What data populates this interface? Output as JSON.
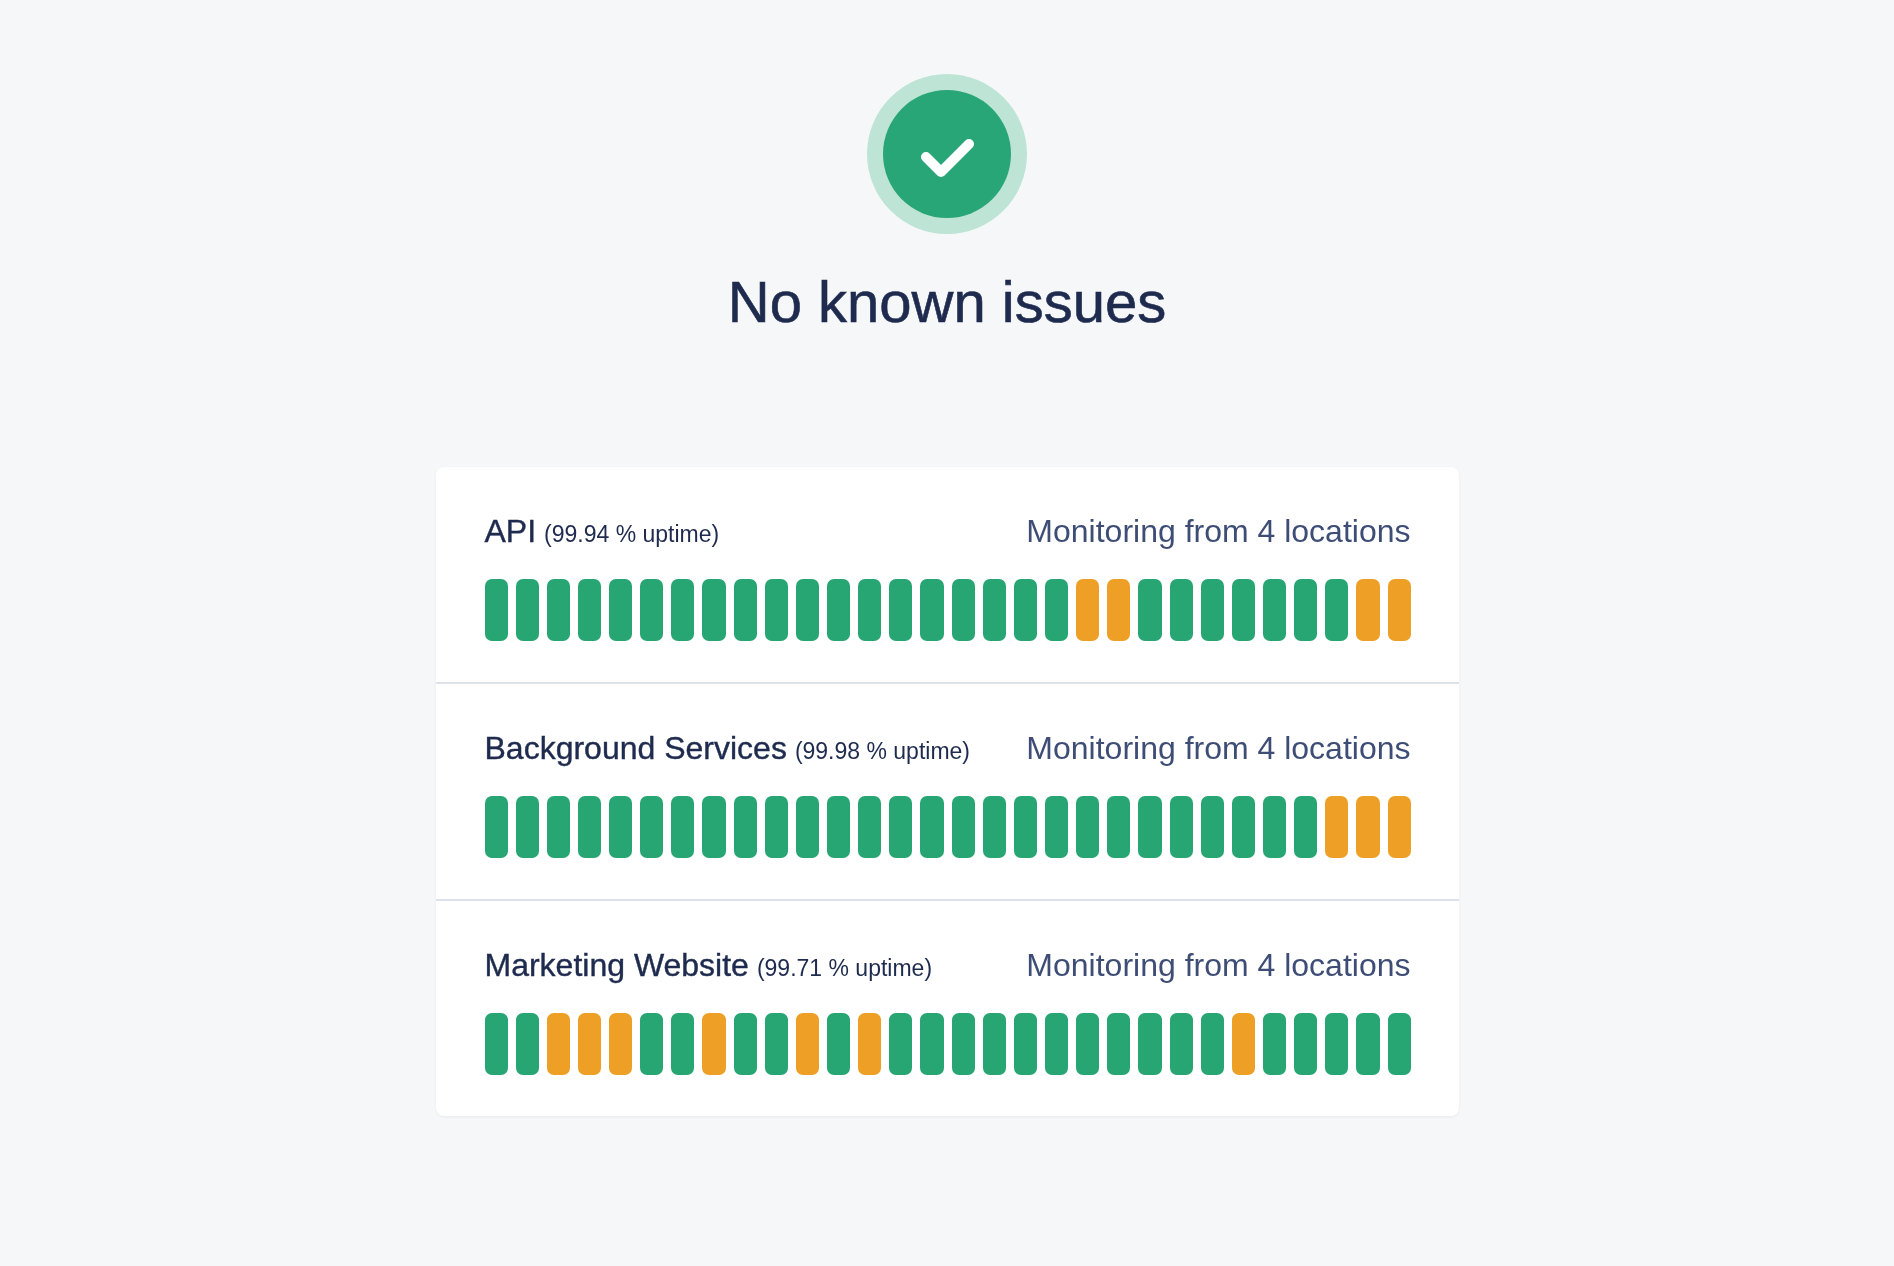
{
  "status": {
    "title": "No known issues"
  },
  "services": [
    {
      "name": "API",
      "uptime": "(99.94 % uptime)",
      "monitoring": "Monitoring from 4 locations",
      "bars": [
        {
          "color": "#27a674"
        },
        {
          "color": "#27a674"
        },
        {
          "color": "#27a674"
        },
        {
          "color": "#27a674"
        },
        {
          "color": "#27a674"
        },
        {
          "color": "#27a674"
        },
        {
          "color": "#27a674"
        },
        {
          "color": "#27a674"
        },
        {
          "color": "#27a674"
        },
        {
          "color": "#27a674"
        },
        {
          "color": "#27a674"
        },
        {
          "color": "#27a674"
        },
        {
          "color": "#27a674"
        },
        {
          "color": "#27a674"
        },
        {
          "color": "#27a674"
        },
        {
          "color": "#27a674"
        },
        {
          "color": "#27a674"
        },
        {
          "color": "#27a674"
        },
        {
          "color": "#27a674"
        },
        {
          "color": "#eda025"
        },
        {
          "color": "#eda025"
        },
        {
          "color": "#27a674"
        },
        {
          "color": "#27a674"
        },
        {
          "color": "#27a674"
        },
        {
          "color": "#27a674"
        },
        {
          "color": "#27a674"
        },
        {
          "color": "#27a674"
        },
        {
          "color": "#27a674"
        },
        {
          "color": "#eda025"
        },
        {
          "color": "#eda025"
        }
      ]
    },
    {
      "name": "Background Services",
      "uptime": "(99.98 % uptime)",
      "monitoring": "Monitoring from 4 locations",
      "bars": [
        {
          "color": "#27a674"
        },
        {
          "color": "#27a674"
        },
        {
          "color": "#27a674"
        },
        {
          "color": "#27a674"
        },
        {
          "color": "#27a674"
        },
        {
          "color": "#27a674"
        },
        {
          "color": "#27a674"
        },
        {
          "color": "#27a674"
        },
        {
          "color": "#27a674"
        },
        {
          "color": "#27a674"
        },
        {
          "color": "#27a674"
        },
        {
          "color": "#27a674"
        },
        {
          "color": "#27a674"
        },
        {
          "color": "#27a674"
        },
        {
          "color": "#27a674"
        },
        {
          "color": "#27a674"
        },
        {
          "color": "#27a674"
        },
        {
          "color": "#27a674"
        },
        {
          "color": "#27a674"
        },
        {
          "color": "#27a674"
        },
        {
          "color": "#27a674"
        },
        {
          "color": "#27a674"
        },
        {
          "color": "#27a674"
        },
        {
          "color": "#27a674"
        },
        {
          "color": "#27a674"
        },
        {
          "color": "#27a674"
        },
        {
          "color": "#27a674"
        },
        {
          "color": "#eda025"
        },
        {
          "color": "#eda025"
        },
        {
          "color": "#eda025"
        }
      ]
    },
    {
      "name": "Marketing Website",
      "uptime": "(99.71 % uptime)",
      "monitoring": "Monitoring from 4 locations",
      "bars": [
        {
          "color": "#27a674"
        },
        {
          "color": "#27a674"
        },
        {
          "color": "#eda025"
        },
        {
          "color": "#eda025"
        },
        {
          "color": "#eda025"
        },
        {
          "color": "#27a674"
        },
        {
          "color": "#27a674"
        },
        {
          "color": "#eda025"
        },
        {
          "color": "#27a674"
        },
        {
          "color": "#27a674"
        },
        {
          "color": "#eda025"
        },
        {
          "color": "#27a674"
        },
        {
          "color": "#eda025"
        },
        {
          "color": "#27a674"
        },
        {
          "color": "#27a674"
        },
        {
          "color": "#27a674"
        },
        {
          "color": "#27a674"
        },
        {
          "color": "#27a674"
        },
        {
          "color": "#27a674"
        },
        {
          "color": "#27a674"
        },
        {
          "color": "#27a674"
        },
        {
          "color": "#27a674"
        },
        {
          "color": "#27a674"
        },
        {
          "color": "#27a674"
        },
        {
          "color": "#eda025"
        },
        {
          "color": "#27a674"
        },
        {
          "color": "#27a674"
        },
        {
          "color": "#27a674"
        },
        {
          "color": "#27a674"
        },
        {
          "color": "#27a674"
        }
      ]
    }
  ]
}
